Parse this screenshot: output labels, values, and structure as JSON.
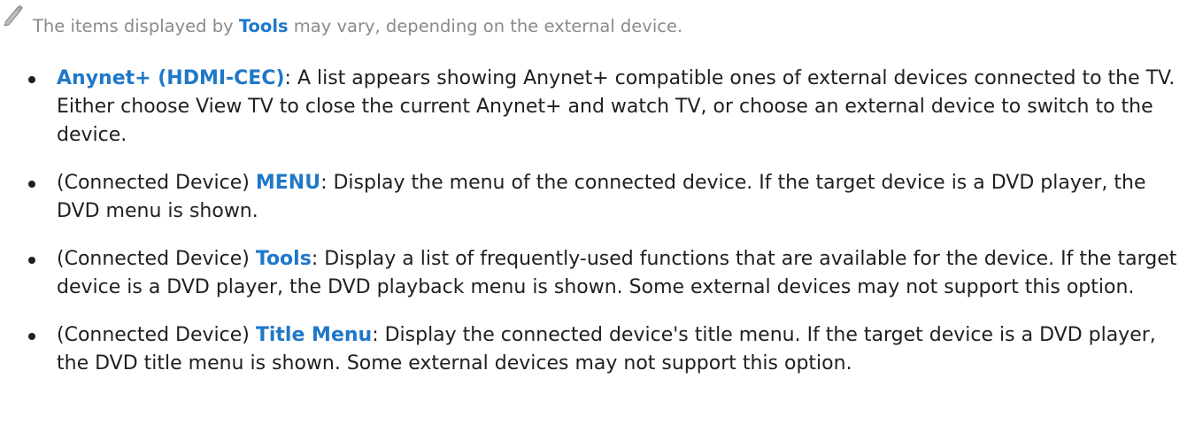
{
  "note": {
    "icon": "pencil-icon",
    "before": "The items displayed by ",
    "term": "Tools",
    "after": " may vary, depending on the external device."
  },
  "bullets": [
    {
      "prefix": "",
      "term": "Anynet+ (HDMI-CEC)",
      "text": ": A list appears showing Anynet+ compatible ones of external devices connected to the TV. Either choose View TV to close the current Anynet+ and watch TV, or choose an external device to switch to the device."
    },
    {
      "prefix": "(Connected Device) ",
      "term": "MENU",
      "text": ": Display the menu of the connected device. If the target device is a DVD player, the DVD menu is shown."
    },
    {
      "prefix": "(Connected Device) ",
      "term": "Tools",
      "text": ": Display a list of frequently-used functions that are available for the device. If the target device is a DVD player, the DVD playback menu is shown. Some external devices may not support this option."
    },
    {
      "prefix": "(Connected Device) ",
      "term": "Title Menu",
      "text": ": Display the connected device's title menu. If the target device is a DVD player, the DVD title menu is shown. Some external devices may not support this option."
    }
  ],
  "colors": {
    "accent": "#1f78c8",
    "note_text": "#8a8a8a",
    "body_text": "#1f1f1f"
  }
}
